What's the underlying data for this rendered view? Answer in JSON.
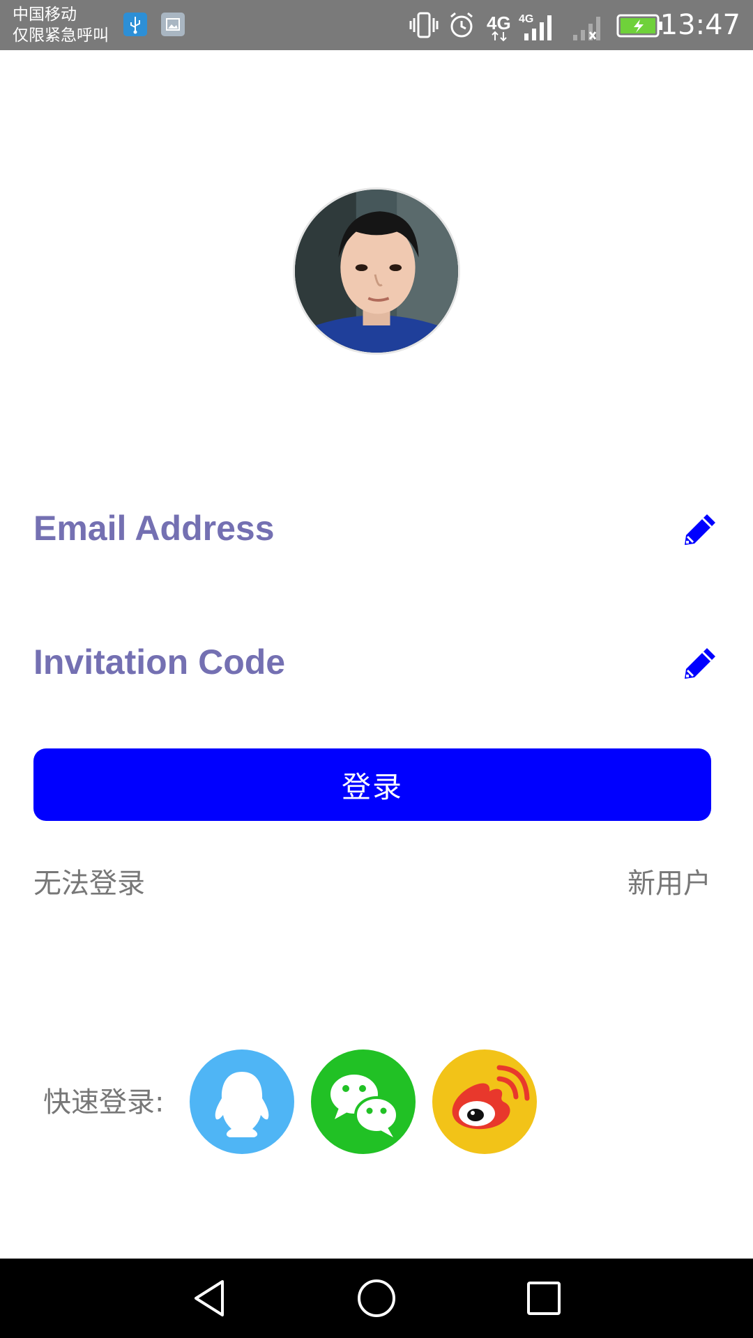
{
  "status_bar": {
    "carrier_line1": "中国移动",
    "carrier_line2": "仅限紧急呼叫",
    "network_label_1": "4G",
    "network_label_2": "4G",
    "time": "13:47"
  },
  "form": {
    "email_label": "Email Address",
    "code_label": "Invitation Code",
    "login_button": "登录",
    "cannot_login": "无法登录",
    "new_user": "新用户"
  },
  "quick_login": {
    "label": "快速登录:",
    "providers": [
      "qq",
      "wechat",
      "weibo"
    ]
  },
  "colors": {
    "accent": "#0000ff",
    "label": "#7470b2",
    "status_bar": "#7a7a7a",
    "qq": "#4fb5f5",
    "wechat": "#21c125",
    "weibo": "#f2c318"
  },
  "icons": {
    "edit": "pencil-icon",
    "nav_back": "back-triangle-icon",
    "nav_home": "home-circle-icon",
    "nav_recent": "recent-square-icon"
  }
}
